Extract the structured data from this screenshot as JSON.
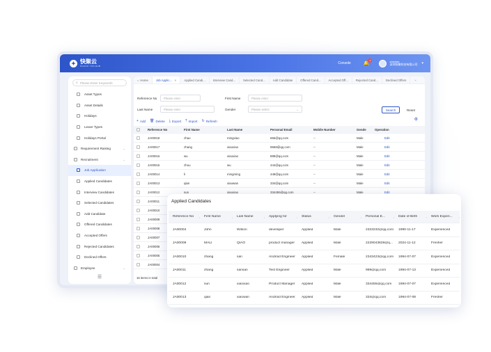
{
  "brand": {
    "name": "快聚云",
    "sub": "KUAIJU YUN HUB",
    "accent": "#2d55c9"
  },
  "header": {
    "console": "Console",
    "notifications": "3",
    "user_name": "chenlan",
    "user_org": "深圳快聚科技有限公司"
  },
  "sidebar": {
    "search_placeholder": "Please Enter Keywords",
    "items": [
      {
        "label": "Asset Types",
        "group": false,
        "active": false
      },
      {
        "label": "Asset Details",
        "group": false,
        "active": false
      },
      {
        "label": "Holidays",
        "group": false,
        "active": false
      },
      {
        "label": "Leave Types",
        "group": false,
        "active": false
      },
      {
        "label": "Holidays Portal",
        "group": false,
        "active": false
      },
      {
        "label": "Requirement Raising",
        "group": true,
        "active": false
      },
      {
        "label": "Recruitment",
        "group": true,
        "active": false
      },
      {
        "label": "Job Application",
        "group": false,
        "active": true
      },
      {
        "label": "Applied Candidates",
        "group": false,
        "active": false
      },
      {
        "label": "Interview Candidates",
        "group": false,
        "active": false
      },
      {
        "label": "Selected Candidates",
        "group": false,
        "active": false
      },
      {
        "label": "Add Candidate",
        "group": false,
        "active": false
      },
      {
        "label": "Offered Candidates",
        "group": false,
        "active": false
      },
      {
        "label": "Accepted Offers",
        "group": false,
        "active": false
      },
      {
        "label": "Rejected Candidates",
        "group": false,
        "active": false
      },
      {
        "label": "Declined Offers",
        "group": false,
        "active": false
      },
      {
        "label": "Employee",
        "group": true,
        "active": false
      }
    ]
  },
  "tabs": [
    {
      "label": "Home",
      "active": false,
      "home": true,
      "closable": false
    },
    {
      "label": "Job Applic...",
      "active": true,
      "home": false,
      "closable": true
    },
    {
      "label": "Applied Candi...",
      "active": false,
      "home": false,
      "closable": false
    },
    {
      "label": "Interview Cand...",
      "active": false,
      "home": false,
      "closable": false
    },
    {
      "label": "Selected Cand...",
      "active": false,
      "home": false,
      "closable": false
    },
    {
      "label": "Add Candidate",
      "active": false,
      "home": false,
      "closable": false
    },
    {
      "label": "Offered Cand...",
      "active": false,
      "home": false,
      "closable": false
    },
    {
      "label": "Accepted Off...",
      "active": false,
      "home": false,
      "closable": false
    },
    {
      "label": "Rejected Cand...",
      "active": false,
      "home": false,
      "closable": false
    },
    {
      "label": "Declined Offers",
      "active": false,
      "home": false,
      "closable": false
    }
  ],
  "filters": {
    "reference_no_label": "Reference No",
    "reference_no_placeholder": "Please enter",
    "first_name_label": "First Name",
    "first_name_placeholder": "Please enter",
    "last_name_label": "Last Name",
    "last_name_placeholder": "Please enter",
    "gender_label": "Gender",
    "gender_placeholder": "Please select",
    "search": "Search",
    "reset": "Reset"
  },
  "toolbar": {
    "add": "Add",
    "delete": "Delete",
    "export": "Export",
    "import": "Import",
    "refresh": "Refresh"
  },
  "grid": {
    "columns": [
      "Reference No",
      "First Name",
      "Last Name",
      "Personal Email",
      "Mobile Number",
      "Gende",
      "Operation"
    ],
    "rows": [
      [
        "JA00018",
        "zhao",
        "mingxiao",
        "666@qq.com",
        "--",
        "Male",
        "Edit"
      ],
      [
        "JA00017",
        "zhang",
        "xiaoxiao",
        "9668@qq.com",
        "--",
        "Male",
        "Edit"
      ],
      [
        "JA00016",
        "wu",
        "xiaoxiao",
        "888@qq.com",
        "--",
        "Male",
        "Edit"
      ],
      [
        "JA00015",
        "zhou",
        "wu",
        "444@qq.com",
        "--",
        "Male",
        "Edit"
      ],
      [
        "JA00014",
        "li",
        "mingming",
        "448@qq.com",
        "--",
        "Male",
        "Edit"
      ],
      [
        "JA00013",
        "qian",
        "xiaowan",
        "334@qq.com",
        "--",
        "Male",
        "Edit"
      ],
      [
        "JA00012",
        "sun",
        "xiaoxiao",
        "334455@qq.com",
        "--",
        "Male",
        "Edit"
      ],
      [
        "JA00011",
        "",
        "",
        "",
        "",
        "",
        ""
      ],
      [
        "JA00010",
        "",
        "",
        "",
        "",
        "",
        ""
      ],
      [
        "JA00009",
        "",
        "",
        "",
        "",
        "",
        ""
      ],
      [
        "JA00008",
        "",
        "",
        "",
        "",
        "",
        ""
      ],
      [
        "JA00007",
        "",
        "",
        "",
        "",
        "",
        ""
      ],
      [
        "JA00006",
        "",
        "",
        "",
        "",
        "",
        ""
      ],
      [
        "JA00005",
        "",
        "",
        "",
        "",
        "",
        ""
      ],
      [
        "JA00004",
        "",
        "",
        "",
        "",
        "",
        ""
      ]
    ],
    "total": "16 items in total"
  },
  "card": {
    "title": "Applied Candidates",
    "columns": [
      "Reference No",
      "First Name",
      "Last Name",
      "Applying for",
      "Status",
      "Gender",
      "Personal E...",
      "Date of Birth",
      "Work Experi..."
    ],
    "rows": [
      [
        "JA00004",
        "John",
        "Wilson",
        "developer",
        "Applied",
        "Male",
        "2323232@qq.com",
        "1990-11-17",
        "Experienced"
      ],
      [
        "JA00008",
        "MALI",
        "QIAO",
        "product manager",
        "Applied",
        "Male",
        "2229043828@q...",
        "2024-11-12",
        "Fresher"
      ],
      [
        "JA00010",
        "zhang",
        "san",
        "Android Engineer",
        "Applied",
        "Female",
        "2343423@qq.com",
        "1994-07-07",
        "Experienced"
      ],
      [
        "JA00011",
        "zhang",
        "sansan",
        "Test Engineer",
        "Applied",
        "Male",
        "999@qq.com",
        "1994-07-13",
        "Experienced"
      ],
      [
        "JA00012",
        "sun",
        "xiaoxiao",
        "Product Manager",
        "Applied",
        "Male",
        "334455@qq.com",
        "1994-07-07",
        "Experienced"
      ],
      [
        "JA00013",
        "qian",
        "xiaowan",
        "Android Engineer",
        "Applied",
        "Male",
        "334@qq.com",
        "1994-07-08",
        "Fresher"
      ]
    ]
  }
}
